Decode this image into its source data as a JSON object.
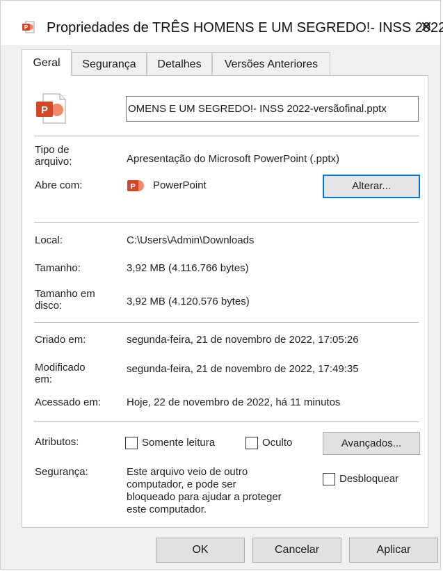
{
  "window": {
    "title": "Propriedades de TRÊS HOMENS E UM SEGREDO!- INSS 2022...",
    "close_glyph": "✕"
  },
  "tabs": [
    {
      "label": "Geral"
    },
    {
      "label": "Segurança"
    },
    {
      "label": "Detalhes"
    },
    {
      "label": "Versões Anteriores"
    }
  ],
  "file": {
    "name_field": "OMENS E UM SEGREDO!- INSS 2022-versãofinal.pptx"
  },
  "info": {
    "type_label": "Tipo de\narquivo:",
    "type_value": "Apresentação do Microsoft PowerPoint (.pptx)",
    "opens_label": "Abre com:",
    "opens_value": "PowerPoint",
    "change_button": "Alterar...",
    "location_label": "Local:",
    "location_value": "C:\\Users\\Admin\\Downloads",
    "size_label": "Tamanho:",
    "size_value": "3,92 MB (4.116.766 bytes)",
    "disk_label": "Tamanho em\ndisco:",
    "disk_value": "3,92 MB (4.120.576 bytes)",
    "created_label": "Criado em:",
    "created_value": "segunda-feira, 21 de novembro de 2022, 17:05:26",
    "modified_label": "Modificado\nem:",
    "modified_value": "segunda-feira, 21 de novembro de 2022, 17:49:35",
    "accessed_label": "Acessado em:",
    "accessed_value": "Hoje, 22 de novembro de 2022, há 11 minutos",
    "attributes_label": "Atributos:",
    "readonly_label": "Somente leitura",
    "hidden_label": "Oculto",
    "advanced_button": "Avançados...",
    "security_label": "Segurança:",
    "security_text": "Este arquivo veio de outro\ncomputador, e pode ser\nbloqueado para ajudar a proteger\neste computador.",
    "unblock_label": "Desbloquear"
  },
  "buttons": {
    "ok": "OK",
    "cancel": "Cancelar",
    "apply": "Aplicar"
  },
  "colors": {
    "powerpoint": "#d24726",
    "focus_border": "#0078d7"
  }
}
